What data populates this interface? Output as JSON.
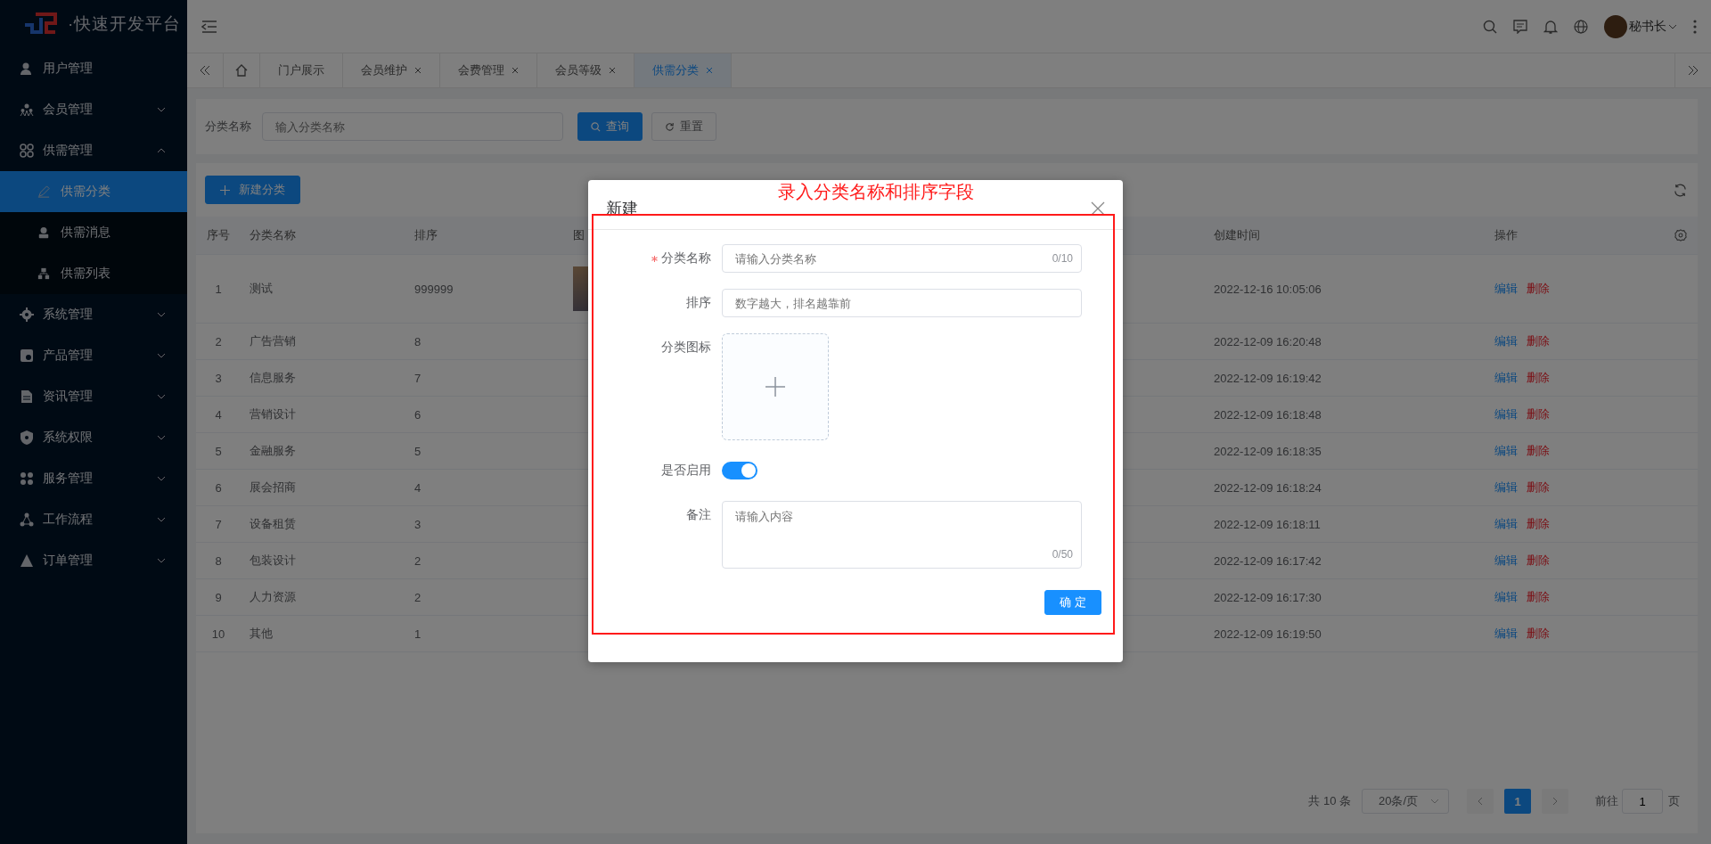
{
  "logo": {
    "text": "·快速开发平台"
  },
  "sidebar": {
    "items": [
      {
        "kind": "link",
        "label": "用户管理"
      },
      {
        "kind": "group",
        "label": "会员管理",
        "expanded": false
      },
      {
        "kind": "group",
        "label": "供需管理",
        "expanded": true,
        "children": [
          {
            "label": "供需分类",
            "selected": true
          },
          {
            "label": "供需消息",
            "selected": false
          },
          {
            "label": "供需列表",
            "selected": false
          }
        ]
      },
      {
        "kind": "group",
        "label": "系统管理",
        "expanded": false
      },
      {
        "kind": "group",
        "label": "产品管理",
        "expanded": false
      },
      {
        "kind": "group",
        "label": "资讯管理",
        "expanded": false
      },
      {
        "kind": "group",
        "label": "系统权限",
        "expanded": false
      },
      {
        "kind": "group",
        "label": "服务管理",
        "expanded": false
      },
      {
        "kind": "group",
        "label": "工作流程",
        "expanded": false
      },
      {
        "kind": "group",
        "label": "订单管理",
        "expanded": false
      }
    ]
  },
  "header": {
    "user": "秘书长"
  },
  "tabs": [
    {
      "label": "门户展示",
      "closable": false,
      "selected": false
    },
    {
      "label": "会员维护",
      "closable": true,
      "selected": false
    },
    {
      "label": "会费管理",
      "closable": true,
      "selected": false
    },
    {
      "label": "会员等级",
      "closable": true,
      "selected": false
    },
    {
      "label": "供需分类",
      "closable": true,
      "selected": true
    }
  ],
  "search": {
    "label": "分类名称",
    "placeholder": "输入分类名称",
    "buttons": [
      {
        "label": "查询",
        "kind": "primary"
      },
      {
        "label": "重置",
        "kind": "reset"
      }
    ]
  },
  "toolbar": {
    "add_button": "新建分类"
  },
  "table": {
    "columns": [
      "序号",
      "分类名称",
      "排序",
      "图",
      "创建时间",
      "操作"
    ],
    "rows": [
      {
        "index": "1",
        "name": "测试",
        "sort": "999999",
        "icon": true,
        "created": "2022-12-16 10:05:06",
        "edit": "编辑",
        "delete": "删除"
      },
      {
        "index": "2",
        "name": "广告营销",
        "sort": "8",
        "icon": false,
        "created": "2022-12-09 16:20:48",
        "edit": "编辑",
        "delete": "删除"
      },
      {
        "index": "3",
        "name": "信息服务",
        "sort": "7",
        "icon": false,
        "created": "2022-12-09 16:19:42",
        "edit": "编辑",
        "delete": "删除"
      },
      {
        "index": "4",
        "name": "营销设计",
        "sort": "6",
        "icon": false,
        "created": "2022-12-09 16:18:48",
        "edit": "编辑",
        "delete": "删除"
      },
      {
        "index": "5",
        "name": "金融服务",
        "sort": "5",
        "icon": false,
        "created": "2022-12-09 16:18:35",
        "edit": "编辑",
        "delete": "删除"
      },
      {
        "index": "6",
        "name": "展会招商",
        "sort": "4",
        "icon": false,
        "created": "2022-12-09 16:18:24",
        "edit": "编辑",
        "delete": "删除"
      },
      {
        "index": "7",
        "name": "设备租赁",
        "sort": "3",
        "icon": false,
        "created": "2022-12-09 16:18:11",
        "edit": "编辑",
        "delete": "删除"
      },
      {
        "index": "8",
        "name": "包装设计",
        "sort": "2",
        "icon": false,
        "created": "2022-12-09 16:17:42",
        "edit": "编辑",
        "delete": "删除"
      },
      {
        "index": "9",
        "name": "人力资源",
        "sort": "2",
        "icon": false,
        "created": "2022-12-09 16:17:30",
        "edit": "编辑",
        "delete": "删除"
      },
      {
        "index": "10",
        "name": "其他",
        "sort": "1",
        "icon": false,
        "created": "2022-12-09 16:19:50",
        "edit": "编辑",
        "delete": "删除"
      }
    ]
  },
  "pagination": {
    "total": "共 10 条",
    "page_size": "20条/页",
    "pages": [
      {
        "label": "1",
        "selected": true
      }
    ],
    "goto_label": "前往",
    "goto_value": "1",
    "page_unit": "页"
  },
  "dialog": {
    "title": "新建",
    "fields": [
      {
        "kind": "text",
        "label": "分类名称",
        "required": true,
        "placeholder": "请输入分类名称",
        "counter": "0/10"
      },
      {
        "kind": "text",
        "label": "排序",
        "required": false,
        "placeholder": "数字越大，排名越靠前"
      },
      {
        "kind": "upload",
        "label": "分类图标"
      },
      {
        "kind": "switch",
        "label": "是否启用",
        "on": true
      },
      {
        "kind": "textarea",
        "label": "备注",
        "placeholder": "请输入内容",
        "counter": "0/50"
      }
    ],
    "confirm": "确 定"
  },
  "annotation": {
    "text": "录入分类名称和排序字段"
  }
}
